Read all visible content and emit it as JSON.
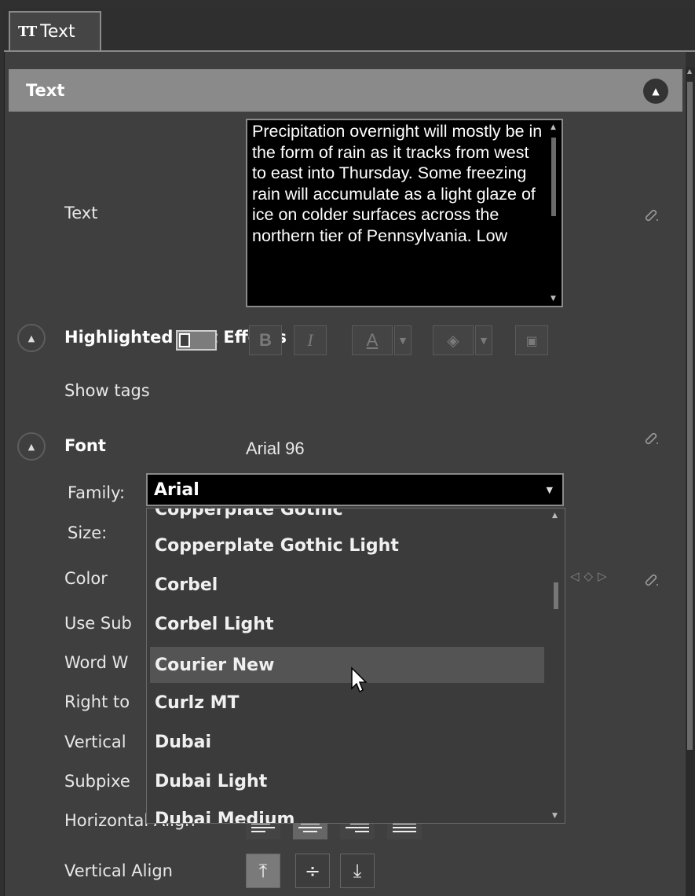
{
  "tab": {
    "icon": "text-type-icon",
    "icon_glyph": "TT",
    "label": "Text"
  },
  "section": {
    "title": "Text"
  },
  "text_field": {
    "label": "Text",
    "value": "Precipitation overnight will mostly be in the form of rain as it tracks from west to east into Thursday. Some freezing rain will accumulate as a light glaze of ice on colder surfaces across the northern tier of Pennsylvania. Low"
  },
  "highlighted": {
    "title": "Highlighted Text Effects",
    "show_tags_label": "Show tags",
    "bold_label": "B",
    "italic_label": "I",
    "font_color_label": "A"
  },
  "font": {
    "title": "Font",
    "summary": "Arial 96",
    "family_label": "Family:",
    "family_value": "Arial",
    "size_label": "Size:"
  },
  "properties": {
    "color": "Color",
    "use_sub": "Use Sub",
    "word_w": "Word W",
    "right_to": "Right to",
    "vertical": "Vertical",
    "subpixe": "Subpixe",
    "horizontal_align": "Horizontal Align",
    "vertical_align": "Vertical Align"
  },
  "font_list": [
    "Copperplate Gothic",
    "Copperplate Gothic Light",
    "Corbel",
    "Corbel Light",
    "Courier New",
    "Curlz MT",
    "Dubai",
    "Dubai Light",
    "Dubai Medium"
  ],
  "font_list_hover": "Courier New",
  "colors": {
    "panel_bg": "#3f3f3f",
    "header_bg": "#8a8a8a",
    "input_bg": "#000000",
    "hover_bg": "#545454"
  }
}
